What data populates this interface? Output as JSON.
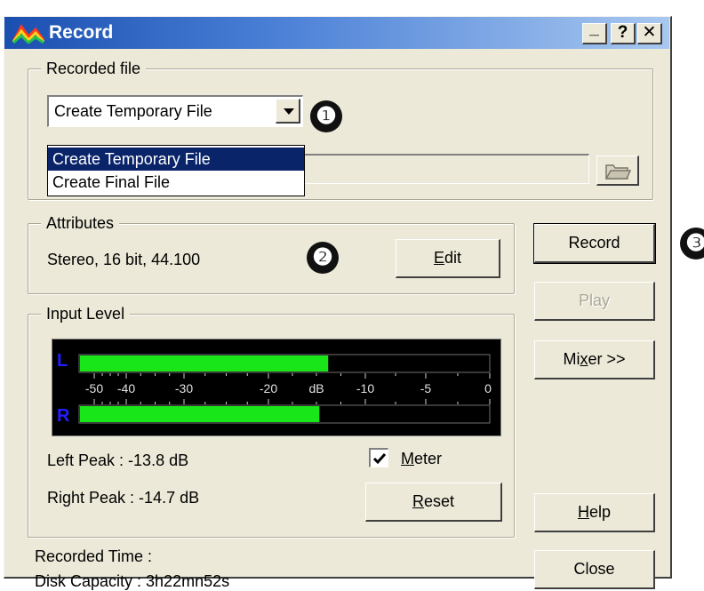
{
  "window": {
    "title": "Record",
    "minimize_label": "_",
    "help_label": "?",
    "close_label": "✕"
  },
  "recorded_file": {
    "legend": "Recorded file",
    "combo_value": "Create Temporary File",
    "options": [
      "Create Temporary File",
      "Create Final File"
    ],
    "selected_index": 0,
    "browse_icon": "folder-open-icon"
  },
  "attributes": {
    "legend": "Attributes",
    "value": "Stereo, 16 bit, 44.100",
    "edit_label_mnemonic": "E",
    "edit_label_rest": "dit"
  },
  "input_level": {
    "legend": "Input Level",
    "left_channel": "L",
    "right_channel": "R",
    "scale": [
      "-50",
      "-40",
      "-30",
      "-20",
      "dB",
      "-10",
      "-5",
      "0"
    ],
    "left_level_db": -13.8,
    "right_level_db": -14.7,
    "left_peak": "Left Peak : -13.8 dB",
    "right_peak": "Right Peak : -14.7 dB",
    "meter_label_mnemonic": "M",
    "meter_label_rest": "eter",
    "meter_checked": true,
    "reset_label_mnemonic": "R",
    "reset_label_rest": "eset",
    "bar_color": "#19e619"
  },
  "buttons": {
    "record": "Record",
    "play": "Play",
    "mixer_pre": "Mi",
    "mixer_mnemonic": "x",
    "mixer_post": "er >>",
    "help_mnemonic": "H",
    "help_rest": "elp",
    "close": "Close"
  },
  "status": {
    "recorded_time": "Recorded Time :",
    "disk_capacity": "Disk Capacity : 3h22mn52s"
  },
  "callouts": [
    "❶",
    "❷",
    "❸"
  ]
}
